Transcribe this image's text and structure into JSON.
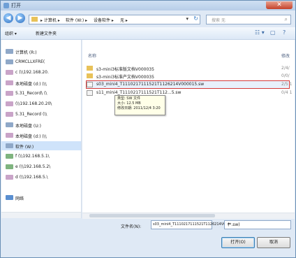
{
  "window": {
    "title": "打开",
    "close_glyph": "✕"
  },
  "nav": {
    "back_glyph": "◀",
    "forward_glyph": "▶"
  },
  "address": {
    "crumbs": [
      "▸ 计算机 ▸",
      "软件 (W:) ▸",
      "设备软件 ▸",
      "无 ▸"
    ],
    "dropdown_glyph": "▾",
    "refresh_glyph": "↻"
  },
  "search": {
    "placeholder": "搜索 无",
    "icon": "search-icon"
  },
  "toolbar": {
    "organize": "组织 ▾",
    "new_folder": "新建文件夹",
    "view_glyph": "☷ ▾",
    "pane_glyph": "▢",
    "help_glyph": "?"
  },
  "sidebar": {
    "items": [
      {
        "label": "计算机 (R:)",
        "icon": "drive-icon"
      },
      {
        "label": "CRMCLLXFRE(",
        "icon": "drive-icon"
      },
      {
        "label": "c (\\\\192.168.20.",
        "icon": "network-drive-icon"
      },
      {
        "label": "本地磁盘 (d:) (\\\\",
        "icon": "network-drive-icon"
      },
      {
        "label": "5.31_Record\\ (\\",
        "icon": "network-drive-icon"
      },
      {
        "label": "(\\\\192.168.20.20\\",
        "icon": "network-drive-icon"
      },
      {
        "label": "5.31_Record (\\\\",
        "icon": "network-drive-icon"
      },
      {
        "label": "本地磁盘 (U:)",
        "icon": "drive-icon"
      },
      {
        "label": "本地磁盘 (d:) (\\\\",
        "icon": "network-drive-icon"
      },
      {
        "label": "软件 (W:)",
        "icon": "drive-icon",
        "selected": true
      },
      {
        "label": "f (\\\\192.168.5.1\\",
        "icon": "network-drive-icon"
      },
      {
        "label": "e (\\\\192.168.5.2\\",
        "icon": "network-drive-icon"
      },
      {
        "label": "d (\\\\192.168.5.\\",
        "icon": "network-drive-icon"
      },
      {
        "label": "网络",
        "icon": "network-icon"
      }
    ]
  },
  "file_list": {
    "columns": {
      "name": "名称",
      "date": "修改"
    },
    "rows": [
      {
        "name": "s3-mini3标准版文档V000035",
        "date": "2/4/",
        "type": "folder"
      },
      {
        "name": "s3-mini3标准产文档V000035",
        "date": "0/0/",
        "type": "folder"
      },
      {
        "name": "s03_mini4_T1110217111521T1126214V000015.sw",
        "date": "2/5 1",
        "type": "file",
        "highlighted": true
      },
      {
        "name": "s11_mini4_T1110217111521T112...5.sw",
        "date": "0/4 1",
        "type": "file"
      }
    ],
    "tooltip": {
      "type": "类型: SW 文件",
      "size": "大小: 12.5 MB",
      "modified": "修改日期: 2011/12/4 3:20"
    }
  },
  "footer": {
    "filename_label": "文件名(N):",
    "filename_value": "s03_mini4_T1110217111521T1126214V0 ▾",
    "filename_dropdown_glyph": "▾",
    "filetype_value": "(*.sw)",
    "filetype_dropdown_glyph": "▾",
    "open_button": "打开(O)",
    "cancel_button": "取消"
  },
  "colors": {
    "accent": "#3c7fb1",
    "highlight_border": "#d53a3a",
    "folder": "#e8c25a",
    "drive": "#8fa8c8"
  }
}
